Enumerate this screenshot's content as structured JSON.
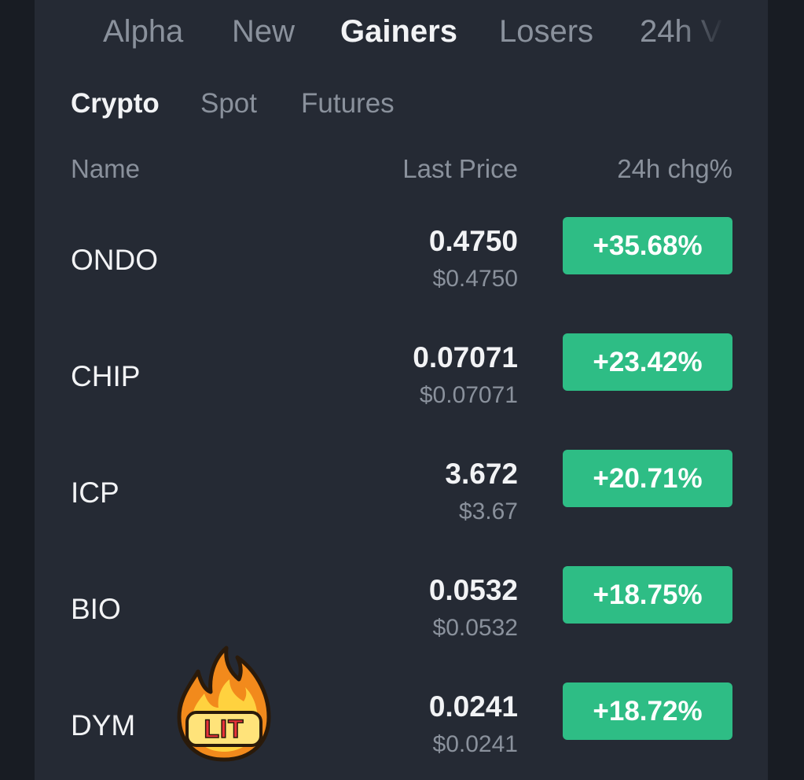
{
  "top_tabs": [
    {
      "label": "Alpha"
    },
    {
      "label": "New"
    },
    {
      "label": "Gainers"
    },
    {
      "label": "Losers"
    },
    {
      "label": "24h V"
    }
  ],
  "sub_tabs": [
    {
      "label": "Crypto"
    },
    {
      "label": "Spot"
    },
    {
      "label": "Futures"
    }
  ],
  "columns": {
    "name": "Name",
    "last_price": "Last Price",
    "change": "24h chg%"
  },
  "rows": [
    {
      "name": "ONDO",
      "price": "0.4750",
      "usd": "$0.4750",
      "change": "+35.68%"
    },
    {
      "name": "CHIP",
      "price": "0.07071",
      "usd": "$0.07071",
      "change": "+23.42%"
    },
    {
      "name": "ICP",
      "price": "3.672",
      "usd": "$3.67",
      "change": "+20.71%"
    },
    {
      "name": "BIO",
      "price": "0.0532",
      "usd": "$0.0532",
      "change": "+18.75%"
    },
    {
      "name": "DYM",
      "price": "0.0241",
      "usd": "$0.0241",
      "change": "+18.72%"
    }
  ],
  "sticker": {
    "text": "LIT",
    "icon": "fire-icon"
  },
  "colors": {
    "background": "#252a34",
    "gain": "#2ebd85",
    "text_primary": "#f2f3f5",
    "text_secondary": "#8a919c"
  }
}
